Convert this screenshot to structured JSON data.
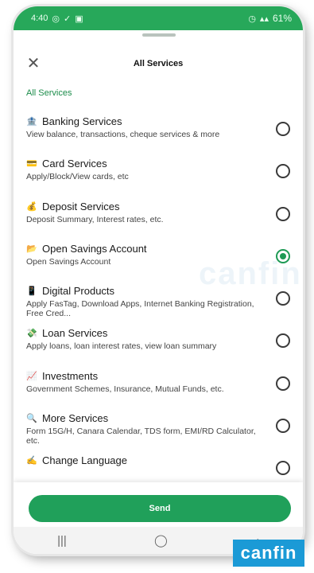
{
  "status_bar": {
    "time": "4:40",
    "battery": "61%"
  },
  "sheet": {
    "title": "All Services",
    "breadcrumb": "All Services"
  },
  "services": [
    {
      "icon": "bank-icon",
      "glyph": "🏦",
      "title": "Banking Services",
      "description": "View balance, transactions, cheque services & more",
      "selected": false
    },
    {
      "icon": "card-icon",
      "glyph": "💳",
      "title": "Card Services",
      "description": "Apply/Block/View cards, etc",
      "selected": false
    },
    {
      "icon": "money-bag-icon",
      "glyph": "💰",
      "title": "Deposit Services",
      "description": "Deposit Summary, Interest rates, etc.",
      "selected": false
    },
    {
      "icon": "folder-icon",
      "glyph": "📂",
      "title": "Open Savings Account",
      "description": "Open Savings Account",
      "selected": true
    },
    {
      "icon": "phone-icon",
      "glyph": "📱",
      "title": "Digital Products",
      "description": "Apply FasTag, Download Apps, Internet Banking Registration, Free Cred...",
      "selected": false
    },
    {
      "icon": "money-wings-icon",
      "glyph": "💸",
      "title": "Loan Services",
      "description": "Apply loans, loan interest rates, view loan summary",
      "selected": false
    },
    {
      "icon": "investment-icon",
      "glyph": "📈",
      "title": "Investments",
      "description": "Government Schemes, Insurance, Mutual Funds, etc.",
      "selected": false
    },
    {
      "icon": "search-icon",
      "glyph": "🔍",
      "title": "More Services",
      "description": "Form 15G/H, Canara Calendar, TDS form, EMI/RD Calculator, etc.",
      "selected": false
    },
    {
      "icon": "writing-hand-icon",
      "glyph": "✍",
      "title": "Change Language",
      "description": "",
      "selected": false
    }
  ],
  "footer": {
    "send_label": "Send"
  },
  "watermark": "canfin",
  "brand": "canfin",
  "colors": {
    "accent": "#20a05a",
    "status_bar": "#27a85a",
    "brand": "#1b9ad6"
  }
}
